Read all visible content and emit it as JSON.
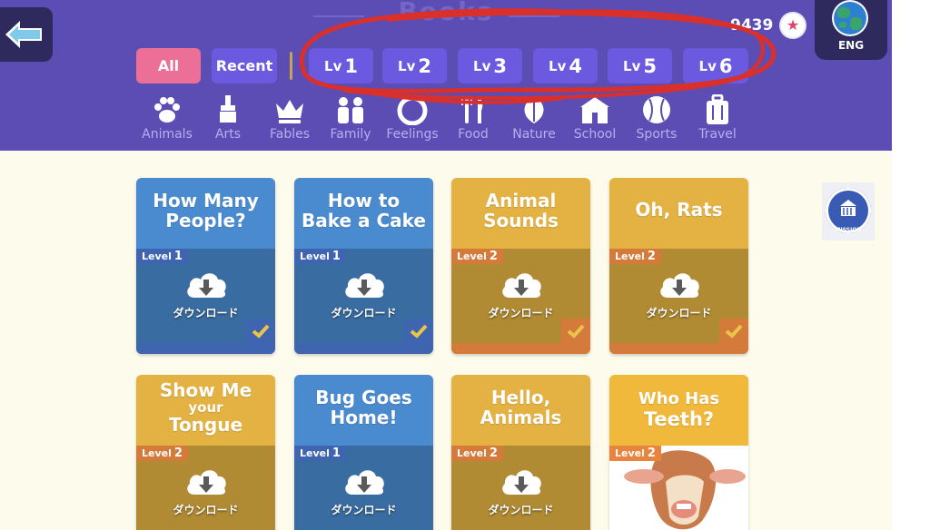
{
  "header": {
    "title": "Books"
  },
  "user": {
    "score": "9439"
  },
  "language": {
    "label": "ENG"
  },
  "filters": {
    "all": "All",
    "recent": "Recent",
    "levels": [
      {
        "prefix": "Lv",
        "num": "1"
      },
      {
        "prefix": "Lv",
        "num": "2"
      },
      {
        "prefix": "Lv",
        "num": "3"
      },
      {
        "prefix": "Lv",
        "num": "4"
      },
      {
        "prefix": "Lv",
        "num": "5"
      },
      {
        "prefix": "Lv",
        "num": "6"
      }
    ]
  },
  "categories": [
    "Animals",
    "Arts",
    "Fables",
    "Family",
    "Feelings",
    "Food",
    "Nature",
    "School",
    "Sports",
    "Travel"
  ],
  "category_icons": [
    "paw-icon",
    "paintbrush-icon",
    "crown-icon",
    "family-icon",
    "feelings-icon",
    "fork-knife-icon",
    "leaf-icon",
    "school-icon",
    "ball-icon",
    "suitcase-icon"
  ],
  "download_label": "ダウンロード",
  "level_word": "Level",
  "books": [
    {
      "title_lines": [
        "How Many",
        "People?"
      ],
      "level": "1",
      "color": "#4a8bcf",
      "tag": "#3f64b0",
      "downloaded": true
    },
    {
      "title_lines": [
        "How to",
        "Bake a Cake"
      ],
      "level": "1",
      "color": "#4a8bcf",
      "tag": "#3f64b0",
      "downloaded": true
    },
    {
      "title_lines": [
        "Animal",
        "Sounds"
      ],
      "level": "2",
      "color": "#e3b242",
      "tag": "#d47a3a",
      "downloaded": true
    },
    {
      "title_lines": [
        "Oh, Rats",
        ""
      ],
      "level": "2",
      "color": "#e3b242",
      "tag": "#d47a3a",
      "downloaded": true
    },
    {
      "title_lines": [
        "Show Me",
        "your",
        "Tongue"
      ],
      "level": "2",
      "color": "#e3b242",
      "tag": "#d47a3a",
      "downloaded": false
    },
    {
      "title_lines": [
        "Bug Goes",
        "Home!"
      ],
      "level": "1",
      "color": "#4a8bcf",
      "tag": "#3f64b0",
      "downloaded": false
    },
    {
      "title_lines": [
        "Hello,",
        "Animals"
      ],
      "level": "2",
      "color": "#e3b242",
      "tag": "#d47a3a",
      "downloaded": false
    },
    {
      "title_lines": [
        "Who Has",
        "Teeth?"
      ],
      "level": "2",
      "color": "#f1b93b",
      "tag": "#e8843d",
      "downloaded": false
    }
  ],
  "mission_label": "MISSION",
  "colors": {
    "header_bg": "#5b4db3",
    "pill": "#6b59e0",
    "pill_active": "#ec6f97",
    "annotation": "#d9302c"
  }
}
